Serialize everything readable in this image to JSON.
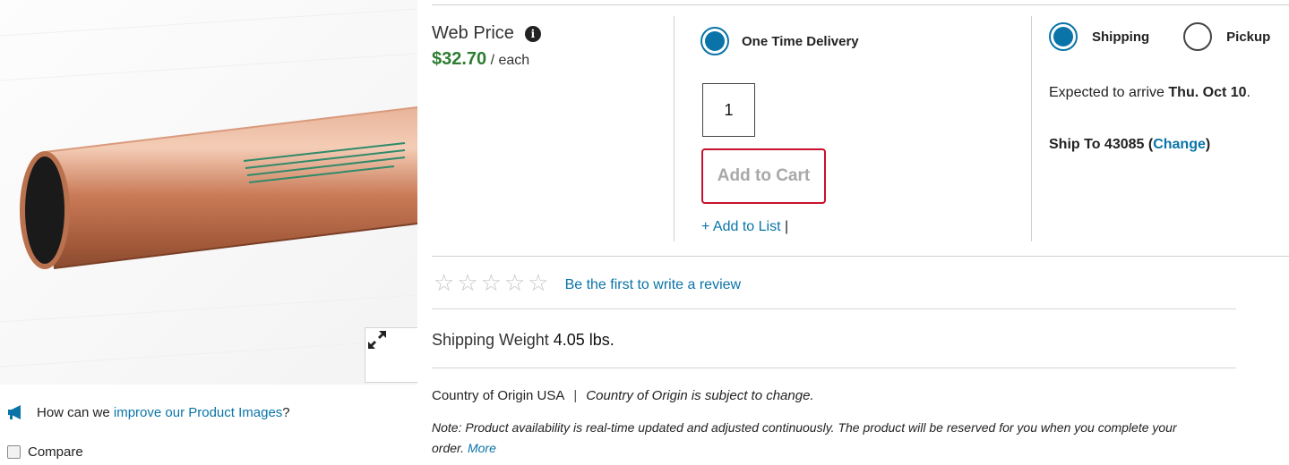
{
  "colors": {
    "accent_blue": "#0a74a8",
    "price_green": "#2e7d32",
    "cart_border_red": "#c8102e",
    "star_gray": "#c4c4c4"
  },
  "image_panel": {
    "expand_icon": "expand-arrows-icon",
    "feedback_icon": "megaphone-icon",
    "feedback_prefix": "How can we ",
    "feedback_link": "improve our Product Images",
    "feedback_suffix": "?",
    "compare_label": "Compare"
  },
  "price": {
    "label": "Web Price",
    "info_icon_glyph": "i",
    "value": "$32.70",
    "unit": " / each"
  },
  "purchase": {
    "delivery_option": "One Time Delivery",
    "quantity": "1",
    "add_to_cart": "Add to Cart",
    "add_to_list": "+ Add to List",
    "list_separator": " |"
  },
  "fulfillment": {
    "shipping_label": "Shipping",
    "pickup_label": "Pickup",
    "selected": "shipping",
    "arrive_prefix": "Expected to arrive ",
    "arrive_date": "Thu. Oct 10",
    "arrive_suffix": ".",
    "ship_to_prefix": "Ship To 43085 (",
    "change_link": "Change",
    "ship_to_suffix": ")"
  },
  "reviews": {
    "rating": 0,
    "max_rating": 5,
    "star_glyph": "☆",
    "link": "Be the first to write a review"
  },
  "details": {
    "weight_label": "Shipping Weight ",
    "weight_value": "4.05 lbs.",
    "origin_label": "Country of Origin USA",
    "origin_separator": "|",
    "origin_note": "Country of Origin is subject to change.",
    "availability_note": "Note: Product availability is real-time updated and adjusted continuously. The product will be reserved for you when you complete your order. ",
    "more_link": "More"
  }
}
